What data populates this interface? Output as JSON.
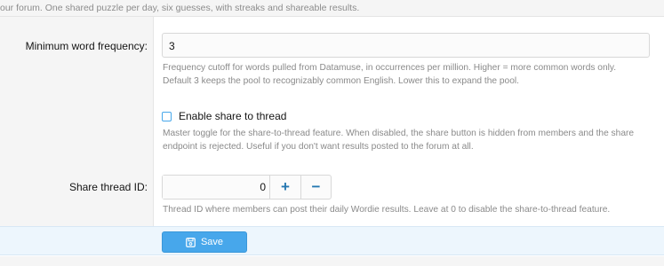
{
  "header": {
    "description": "our forum. One shared puzzle per day, six guesses, with streaks and shareable results."
  },
  "fields": {
    "min_word_frequency": {
      "label": "Minimum word frequency:",
      "value": "3",
      "explain_line1": "Frequency cutoff for words pulled from Datamuse, in occurrences per million. Higher = more common words only.",
      "explain_line2": "Default 3 keeps the pool to recognizably common English. Lower this to expand the pool."
    },
    "share_to_thread": {
      "label": "Enable share to thread",
      "checked": false,
      "explain_line1": "Master toggle for the share-to-thread feature. When disabled, the share button is hidden from members and the share",
      "explain_line2": "endpoint is rejected. Useful if you don't want results posted to the forum at all."
    },
    "share_thread_id": {
      "label": "Share thread ID:",
      "value": "0",
      "increment_glyph": "+",
      "decrement_glyph": "−",
      "explain": "Thread ID where members can post their daily Wordie results. Leave at 0 to disable the share-to-thread feature."
    }
  },
  "footer": {
    "save_label": "Save",
    "save_icon": "save-icon"
  },
  "colors": {
    "accent": "#47a7eb",
    "link_blue": "#2577b1",
    "muted_text": "#8a8a8a",
    "footer_bg": "#edf6fd"
  }
}
